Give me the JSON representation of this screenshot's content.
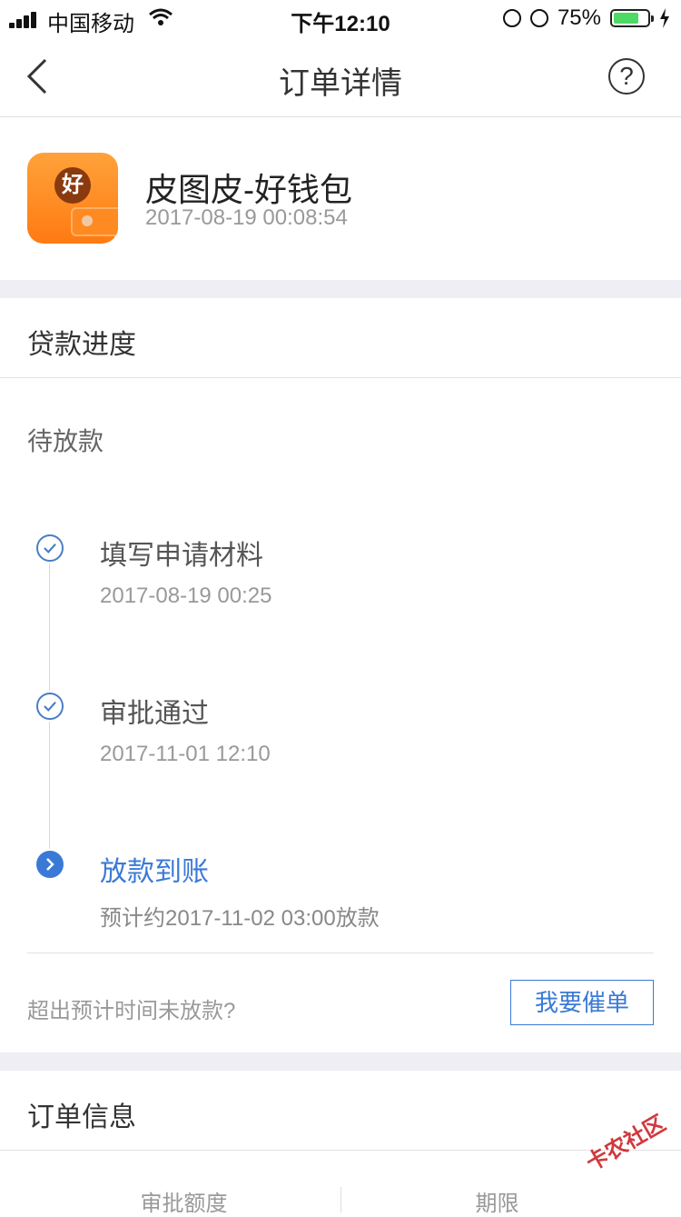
{
  "status_bar": {
    "carrier": "中国移动",
    "time": "下午12:10",
    "battery_percent": "75%",
    "battery_level": 0.75
  },
  "nav": {
    "title": "订单详情",
    "help_symbol": "?"
  },
  "app": {
    "icon_badge": "好",
    "name": "皮图皮-好钱包",
    "datetime": "2017-08-19 00:08:54"
  },
  "progress": {
    "section_title": "贷款进度",
    "status": "待放款",
    "steps": [
      {
        "title": "填写申请材料",
        "sub": "2017-08-19 00:25",
        "state": "done"
      },
      {
        "title": "审批通过",
        "sub": "2017-11-01 12:10",
        "state": "done"
      },
      {
        "title": "放款到账",
        "sub": "预计约2017-11-02 03:00放款",
        "state": "current"
      }
    ],
    "urge_question": "超出预计时间未放款?",
    "urge_button": "我要催单"
  },
  "order_info": {
    "section_title": "订单信息",
    "columns": [
      "审批额度",
      "期限"
    ]
  },
  "watermark": "卡农社区",
  "colors": {
    "accent": "#3a7ad6",
    "section_gap": "#eeeef4",
    "app_icon_orange": "#ff7a12",
    "battery_green": "#4cd964"
  }
}
